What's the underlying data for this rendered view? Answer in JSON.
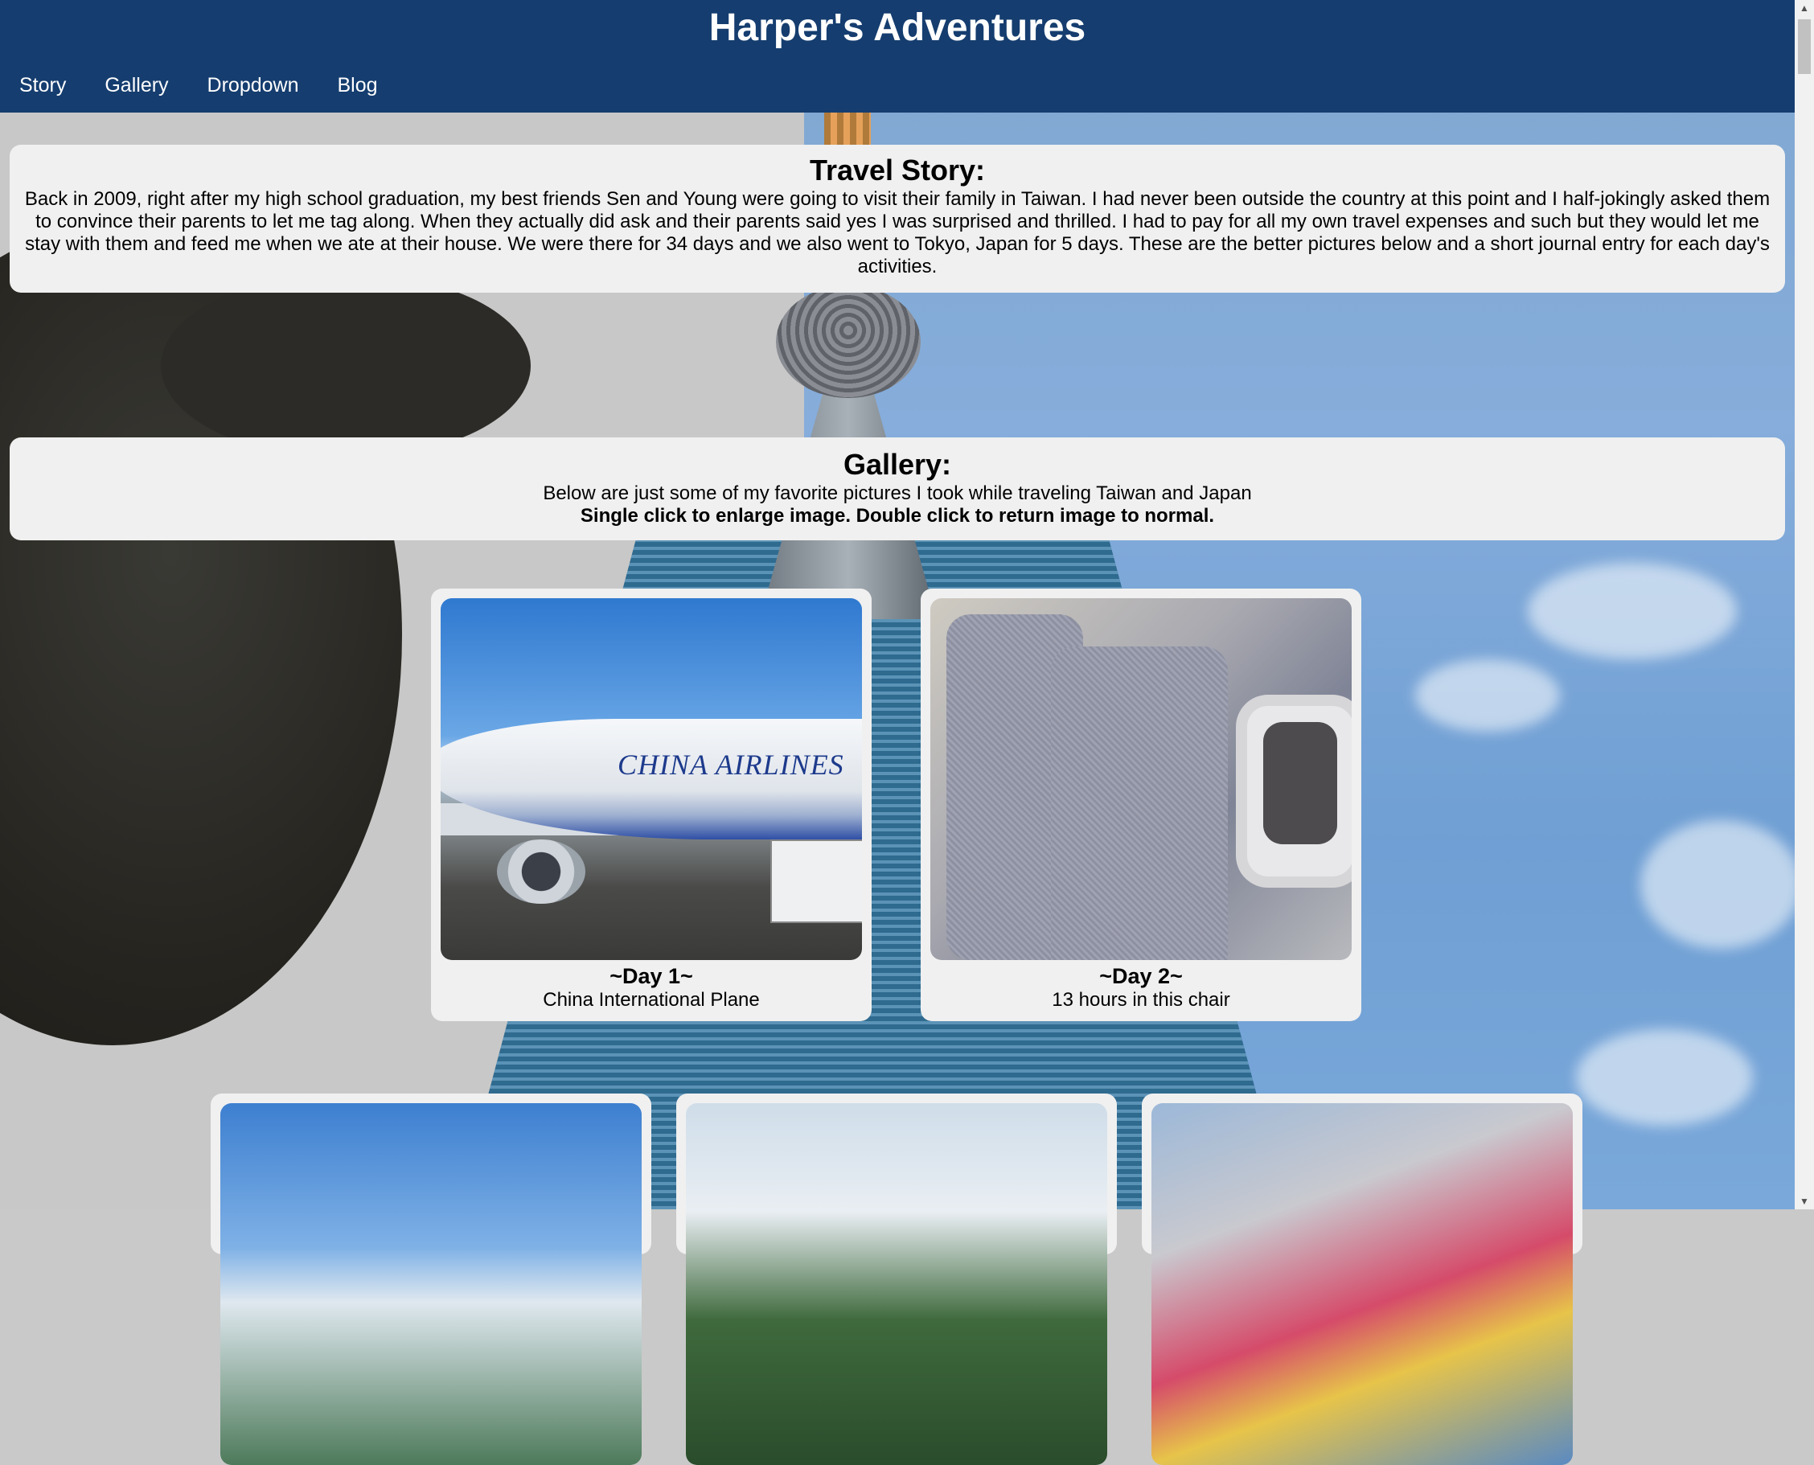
{
  "site_title": "Harper's Adventures",
  "nav": [
    {
      "label": "Story"
    },
    {
      "label": "Gallery"
    },
    {
      "label": "Dropdown"
    },
    {
      "label": "Blog"
    }
  ],
  "story": {
    "heading": "Travel Story:",
    "body": "Back in 2009, right after my high school graduation, my best friends Sen and Young were going to visit their family in Taiwan. I had never been outside the country at this point and I half-jokingly asked them to convince their parents to let me tag along. When they actually did ask and their parents said yes I was surprised and thrilled. I had to pay for all my own travel expenses and such but they would let me stay with them and feed me when we ate at their house. We were there for 34 days and we also went to Tokyo, Japan for 5 days. These are the better pictures below and a short journal entry for each day's activities."
  },
  "gallery": {
    "heading": "Gallery:",
    "intro": "Below are just some of my favorite pictures I took while traveling Taiwan and Japan",
    "instructions": "Single click to enlarge image. Double click to return image to normal.",
    "cards": [
      {
        "day": "~Day 1~",
        "caption": "China International Plane",
        "photo_text": "CHINA AIRLINES"
      },
      {
        "day": "~Day 2~",
        "caption": "13 hours in this chair"
      }
    ]
  }
}
